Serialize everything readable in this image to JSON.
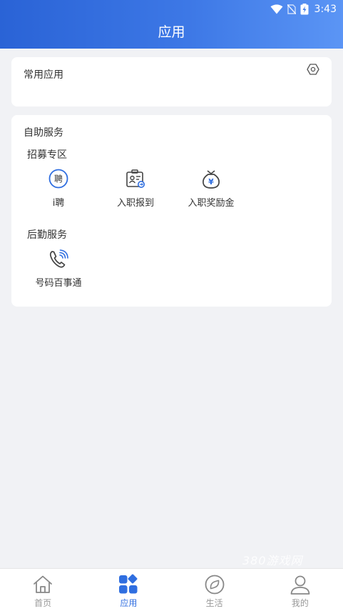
{
  "status_bar": {
    "time": "3:43"
  },
  "header": {
    "title": "应用"
  },
  "common_apps": {
    "title": "常用应用"
  },
  "self_service": {
    "title": "自助服务",
    "sections": [
      {
        "title": "招募专区",
        "items": [
          {
            "label": "i聘",
            "icon": "pin-icon",
            "glyph": "聘"
          },
          {
            "label": "入职报到",
            "icon": "id-card-icon"
          },
          {
            "label": "入职奖励金",
            "icon": "money-bag-icon",
            "glyph": "¥"
          }
        ]
      },
      {
        "title": "后勤服务",
        "items": [
          {
            "label": "号码百事通",
            "icon": "phone-call-icon"
          }
        ]
      }
    ]
  },
  "watermark": "380游戏网",
  "tabbar": {
    "items": [
      {
        "label": "首页",
        "icon": "home-icon",
        "active": false
      },
      {
        "label": "应用",
        "icon": "apps-icon",
        "active": true
      },
      {
        "label": "生活",
        "icon": "compass-icon",
        "active": false
      },
      {
        "label": "我的",
        "icon": "user-icon",
        "active": false
      }
    ]
  },
  "colors": {
    "primary": "#2f6ee0",
    "header_start": "#2a63d6",
    "header_end": "#5b95f5",
    "background": "#f1f2f5",
    "tab_inactive": "#999999"
  }
}
